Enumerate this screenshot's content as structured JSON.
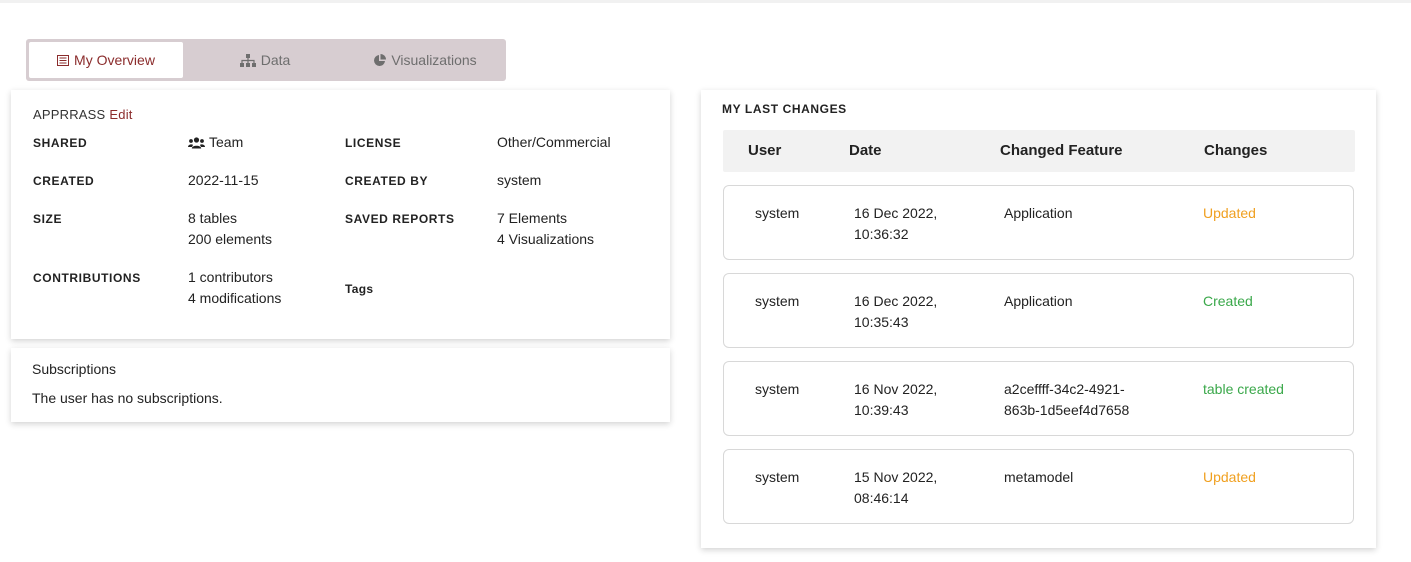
{
  "tabs": [
    {
      "label": "My Overview",
      "icon": "list-icon",
      "active": true
    },
    {
      "label": "Data",
      "icon": "hierarchy-icon",
      "active": false
    },
    {
      "label": "Visualizations",
      "icon": "pie-chart-icon",
      "active": false
    }
  ],
  "overview": {
    "app_name": "APPRRASS",
    "edit_label": "Edit",
    "shared_label": "SHARED",
    "shared_value": "Team",
    "license_label": "LICENSE",
    "license_value": "Other/Commercial",
    "created_label": "CREATED",
    "created_value": "2022-11-15",
    "created_by_label": "CREATED BY",
    "created_by_value": "system",
    "size_label": "SIZE",
    "size_tables": "8 tables",
    "size_elements": "200 elements",
    "saved_reports_label": "SAVED REPORTS",
    "saved_elements": "7 Elements",
    "saved_visualizations": "4 Visualizations",
    "contributions_label": "CONTRIBUTIONS",
    "contributors": "1 contributors",
    "modifications": "4 modifications",
    "tags_label": "Tags"
  },
  "subscriptions": {
    "title": "Subscriptions",
    "empty_text": "The user has no subscriptions."
  },
  "changes": {
    "title": "MY LAST CHANGES",
    "headers": {
      "user": "User",
      "date": "Date",
      "feature": "Changed Feature",
      "changes": "Changes"
    },
    "rows": [
      {
        "user": "system",
        "date1": "16 Dec 2022,",
        "date2": "10:36:32",
        "feature1": "Application",
        "feature2": "",
        "change": "Updated",
        "status": "updated"
      },
      {
        "user": "system",
        "date1": "16 Dec 2022,",
        "date2": "10:35:43",
        "feature1": "Application",
        "feature2": "",
        "change": "Created",
        "status": "created"
      },
      {
        "user": "system",
        "date1": "16 Nov 2022,",
        "date2": "10:39:43",
        "feature1": "a2ceffff-34c2-4921-",
        "feature2": "863b-1d5eef4d7658",
        "change": "table created",
        "status": "created"
      },
      {
        "user": "system",
        "date1": "15 Nov 2022,",
        "date2": "08:46:14",
        "feature1": "metamodel",
        "feature2": "",
        "change": "Updated",
        "status": "updated"
      }
    ]
  },
  "colors": {
    "accent": "#8b2c2c",
    "updated": "#f0a020",
    "created": "#3aa84a",
    "tab_bar": "#d7cdd1"
  }
}
